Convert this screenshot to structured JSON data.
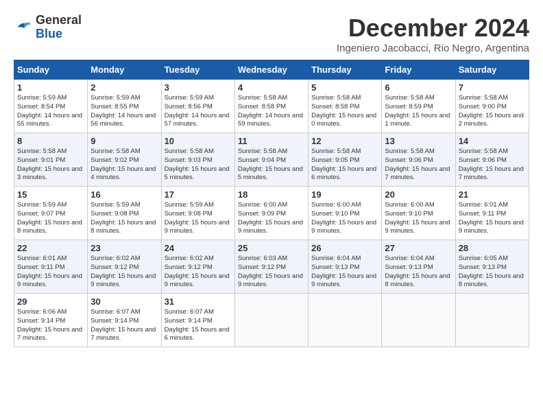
{
  "logo": {
    "line1": "General",
    "line2": "Blue"
  },
  "title": "December 2024",
  "location": "Ingeniero Jacobacci, Rio Negro, Argentina",
  "days_of_week": [
    "Sunday",
    "Monday",
    "Tuesday",
    "Wednesday",
    "Thursday",
    "Friday",
    "Saturday"
  ],
  "weeks": [
    [
      {
        "day": "1",
        "sunrise": "Sunrise: 5:59 AM",
        "sunset": "Sunset: 8:54 PM",
        "daylight": "Daylight: 14 hours and 55 minutes."
      },
      {
        "day": "2",
        "sunrise": "Sunrise: 5:59 AM",
        "sunset": "Sunset: 8:55 PM",
        "daylight": "Daylight: 14 hours and 56 minutes."
      },
      {
        "day": "3",
        "sunrise": "Sunrise: 5:59 AM",
        "sunset": "Sunset: 8:56 PM",
        "daylight": "Daylight: 14 hours and 57 minutes."
      },
      {
        "day": "4",
        "sunrise": "Sunrise: 5:58 AM",
        "sunset": "Sunset: 8:58 PM",
        "daylight": "Daylight: 14 hours and 59 minutes."
      },
      {
        "day": "5",
        "sunrise": "Sunrise: 5:58 AM",
        "sunset": "Sunset: 8:58 PM",
        "daylight": "Daylight: 15 hours and 0 minutes."
      },
      {
        "day": "6",
        "sunrise": "Sunrise: 5:58 AM",
        "sunset": "Sunset: 8:59 PM",
        "daylight": "Daylight: 15 hours and 1 minute."
      },
      {
        "day": "7",
        "sunrise": "Sunrise: 5:58 AM",
        "sunset": "Sunset: 9:00 PM",
        "daylight": "Daylight: 15 hours and 2 minutes."
      }
    ],
    [
      {
        "day": "8",
        "sunrise": "Sunrise: 5:58 AM",
        "sunset": "Sunset: 9:01 PM",
        "daylight": "Daylight: 15 hours and 3 minutes."
      },
      {
        "day": "9",
        "sunrise": "Sunrise: 5:58 AM",
        "sunset": "Sunset: 9:02 PM",
        "daylight": "Daylight: 15 hours and 4 minutes."
      },
      {
        "day": "10",
        "sunrise": "Sunrise: 5:58 AM",
        "sunset": "Sunset: 9:03 PM",
        "daylight": "Daylight: 15 hours and 5 minutes."
      },
      {
        "day": "11",
        "sunrise": "Sunrise: 5:58 AM",
        "sunset": "Sunset: 9:04 PM",
        "daylight": "Daylight: 15 hours and 5 minutes."
      },
      {
        "day": "12",
        "sunrise": "Sunrise: 5:58 AM",
        "sunset": "Sunset: 9:05 PM",
        "daylight": "Daylight: 15 hours and 6 minutes."
      },
      {
        "day": "13",
        "sunrise": "Sunrise: 5:58 AM",
        "sunset": "Sunset: 9:06 PM",
        "daylight": "Daylight: 15 hours and 7 minutes."
      },
      {
        "day": "14",
        "sunrise": "Sunrise: 5:58 AM",
        "sunset": "Sunset: 9:06 PM",
        "daylight": "Daylight: 15 hours and 7 minutes."
      }
    ],
    [
      {
        "day": "15",
        "sunrise": "Sunrise: 5:59 AM",
        "sunset": "Sunset: 9:07 PM",
        "daylight": "Daylight: 15 hours and 8 minutes."
      },
      {
        "day": "16",
        "sunrise": "Sunrise: 5:59 AM",
        "sunset": "Sunset: 9:08 PM",
        "daylight": "Daylight: 15 hours and 8 minutes."
      },
      {
        "day": "17",
        "sunrise": "Sunrise: 5:59 AM",
        "sunset": "Sunset: 9:08 PM",
        "daylight": "Daylight: 15 hours and 9 minutes."
      },
      {
        "day": "18",
        "sunrise": "Sunrise: 6:00 AM",
        "sunset": "Sunset: 9:09 PM",
        "daylight": "Daylight: 15 hours and 9 minutes."
      },
      {
        "day": "19",
        "sunrise": "Sunrise: 6:00 AM",
        "sunset": "Sunset: 9:10 PM",
        "daylight": "Daylight: 15 hours and 9 minutes."
      },
      {
        "day": "20",
        "sunrise": "Sunrise: 6:00 AM",
        "sunset": "Sunset: 9:10 PM",
        "daylight": "Daylight: 15 hours and 9 minutes."
      },
      {
        "day": "21",
        "sunrise": "Sunrise: 6:01 AM",
        "sunset": "Sunset: 9:11 PM",
        "daylight": "Daylight: 15 hours and 9 minutes."
      }
    ],
    [
      {
        "day": "22",
        "sunrise": "Sunrise: 6:01 AM",
        "sunset": "Sunset: 9:11 PM",
        "daylight": "Daylight: 15 hours and 9 minutes."
      },
      {
        "day": "23",
        "sunrise": "Sunrise: 6:02 AM",
        "sunset": "Sunset: 9:12 PM",
        "daylight": "Daylight: 15 hours and 9 minutes."
      },
      {
        "day": "24",
        "sunrise": "Sunrise: 6:02 AM",
        "sunset": "Sunset: 9:12 PM",
        "daylight": "Daylight: 15 hours and 9 minutes."
      },
      {
        "day": "25",
        "sunrise": "Sunrise: 6:03 AM",
        "sunset": "Sunset: 9:12 PM",
        "daylight": "Daylight: 15 hours and 9 minutes."
      },
      {
        "day": "26",
        "sunrise": "Sunrise: 6:04 AM",
        "sunset": "Sunset: 9:13 PM",
        "daylight": "Daylight: 15 hours and 9 minutes."
      },
      {
        "day": "27",
        "sunrise": "Sunrise: 6:04 AM",
        "sunset": "Sunset: 9:13 PM",
        "daylight": "Daylight: 15 hours and 8 minutes."
      },
      {
        "day": "28",
        "sunrise": "Sunrise: 6:05 AM",
        "sunset": "Sunset: 9:13 PM",
        "daylight": "Daylight: 15 hours and 8 minutes."
      }
    ],
    [
      {
        "day": "29",
        "sunrise": "Sunrise: 6:06 AM",
        "sunset": "Sunset: 9:14 PM",
        "daylight": "Daylight: 15 hours and 7 minutes."
      },
      {
        "day": "30",
        "sunrise": "Sunrise: 6:07 AM",
        "sunset": "Sunset: 9:14 PM",
        "daylight": "Daylight: 15 hours and 7 minutes."
      },
      {
        "day": "31",
        "sunrise": "Sunrise: 6:07 AM",
        "sunset": "Sunset: 9:14 PM",
        "daylight": "Daylight: 15 hours and 6 minutes."
      },
      null,
      null,
      null,
      null
    ]
  ]
}
